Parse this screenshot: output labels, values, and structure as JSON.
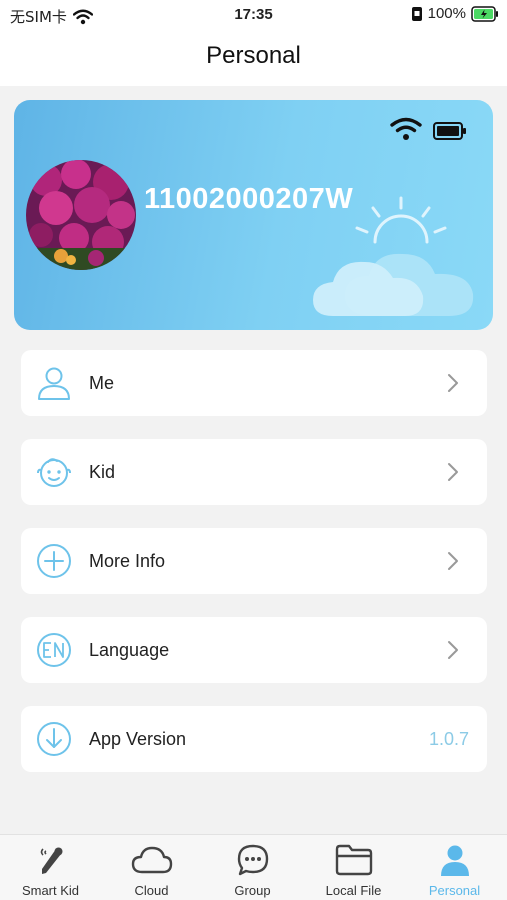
{
  "status_bar": {
    "carrier": "无SIM卡",
    "time": "17:35",
    "battery": "100%"
  },
  "header": {
    "title": "Personal"
  },
  "device_card": {
    "device_id": "11002000207W",
    "icons": [
      "wifi-icon",
      "battery-icon",
      "sun-cloud-icon"
    ]
  },
  "menu": [
    {
      "label": "Me",
      "icon": "person-icon"
    },
    {
      "label": "Kid",
      "icon": "kid-face-icon"
    },
    {
      "label": "More Info",
      "icon": "plus-circle-icon"
    },
    {
      "label": "Language",
      "icon": "en-language-icon"
    },
    {
      "label": "App Version",
      "icon": "download-circle-icon",
      "value": "1.0.7"
    }
  ],
  "tabs": [
    {
      "label": "Smart Kid",
      "icon": "pen-icon"
    },
    {
      "label": "Cloud",
      "icon": "cloud-icon"
    },
    {
      "label": "Group",
      "icon": "chat-icon"
    },
    {
      "label": "Local File",
      "icon": "folder-icon"
    },
    {
      "label": "Personal",
      "icon": "person-filled-icon",
      "active": true
    }
  ],
  "colors": {
    "accent": "#5bb8ea",
    "card_start": "#5fb4e6",
    "card_end": "#8ad9f7",
    "background": "#f2f2f2"
  }
}
